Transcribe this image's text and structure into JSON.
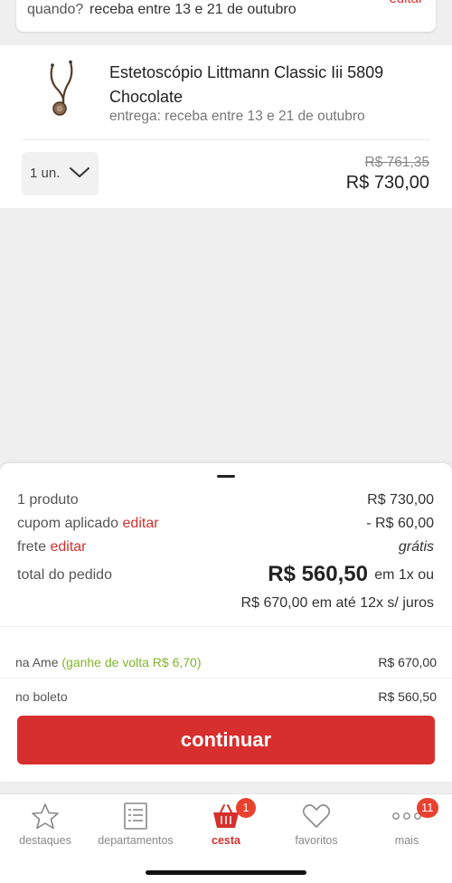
{
  "delivery_card": {
    "question": "quando?",
    "value": "receba entre 13 e 21 de outubro",
    "edit": "editar"
  },
  "product": {
    "name": "Estetoscópio Littmann Classic Iii 5809 Chocolate",
    "delivery": "entrega: receba entre 13 e 21 de outubro",
    "quantity": "1 un.",
    "old_price": "R$ 761,35",
    "price": "R$ 730,00"
  },
  "summary": {
    "products_label": "1 produto",
    "products_value": "R$ 730,00",
    "coupon_label": "cupom aplicado",
    "coupon_edit": "editar",
    "coupon_value": "- R$ 60,00",
    "shipping_label": "frete",
    "shipping_edit": "editar",
    "shipping_value": "grátis",
    "total_label": "total do pedido",
    "total_value": "R$ 560,50",
    "total_suffix": "em 1x ou",
    "installments": "R$ 670,00 em até 12x s/ juros"
  },
  "payment": {
    "ame_label": "na Ame",
    "ame_cashback": "(ganhe de volta R$ 6,70)",
    "ame_value": "R$ 670,00",
    "boleto_label": "no boleto",
    "boleto_value": "R$ 560,50"
  },
  "continue_label": "continuar",
  "tabs": [
    {
      "label": "destaques",
      "icon": "star-icon"
    },
    {
      "label": "departamentos",
      "icon": "list-icon"
    },
    {
      "label": "cesta",
      "icon": "basket-icon",
      "badge": "1",
      "active": true
    },
    {
      "label": "favoritos",
      "icon": "heart-icon"
    },
    {
      "label": "mais",
      "icon": "more-icon",
      "badge": "11"
    }
  ],
  "colors": {
    "accent": "#d62f2d",
    "success": "#7fb529"
  }
}
